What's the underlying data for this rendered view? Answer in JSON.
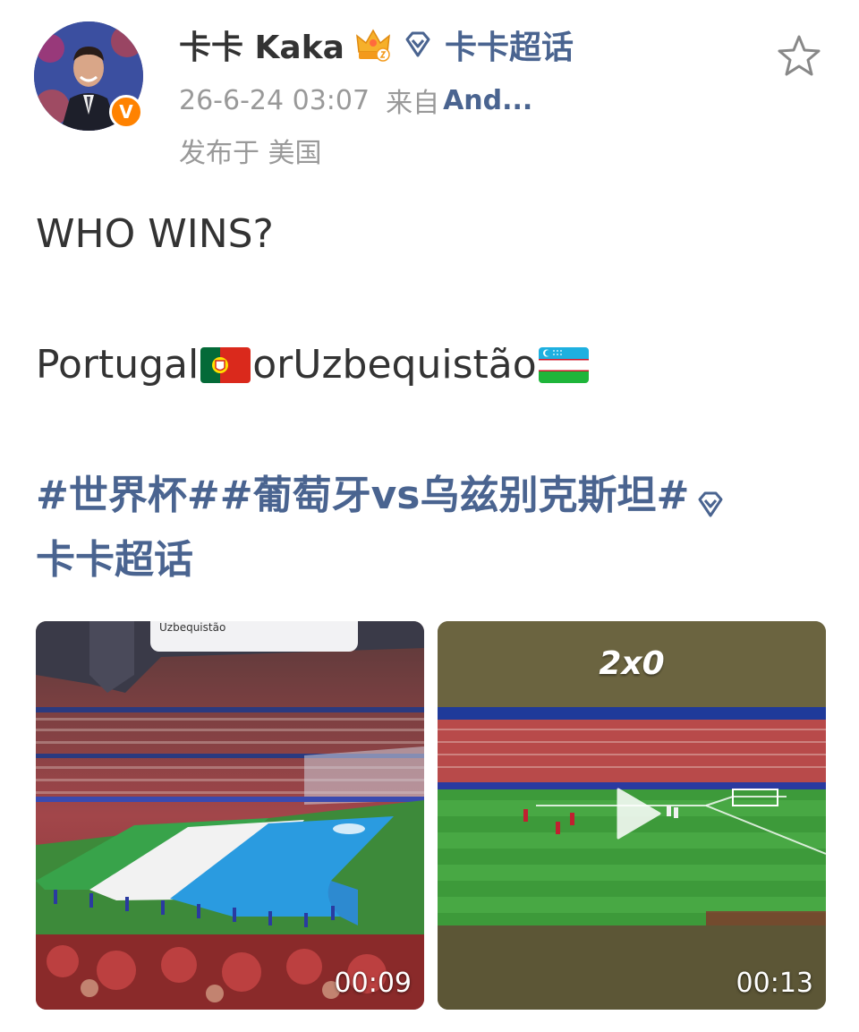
{
  "post": {
    "author": {
      "name": "卡卡 Kaka",
      "verified_badge": "V",
      "supertopic": "卡卡超话"
    },
    "meta": {
      "timestamp": "26-6-24 03:07",
      "source_label": "来自",
      "source": "And...",
      "location": "发布于 美国"
    },
    "text": {
      "line1": "WHO WINS?",
      "team1": "Portugal",
      "connector": "or",
      "team2": "Uzbequistão",
      "hashtags_line1": "#世界杯##葡萄牙vs乌兹别克斯坦#",
      "hashtags_line2": "卡卡超话"
    },
    "videos": [
      {
        "caption": "Uzbequistão",
        "duration": "00:09"
      },
      {
        "score": "2x0",
        "duration": "00:13"
      }
    ]
  },
  "icons": {
    "crown": "crown-badge-icon",
    "diamond": "diamond-icon",
    "favorite": "star-icon",
    "verified": "verified-v-icon",
    "play": "play-icon"
  },
  "colors": {
    "link": "#4a6490",
    "text": "#333333",
    "meta": "#999999",
    "verified": "#ff8200"
  }
}
